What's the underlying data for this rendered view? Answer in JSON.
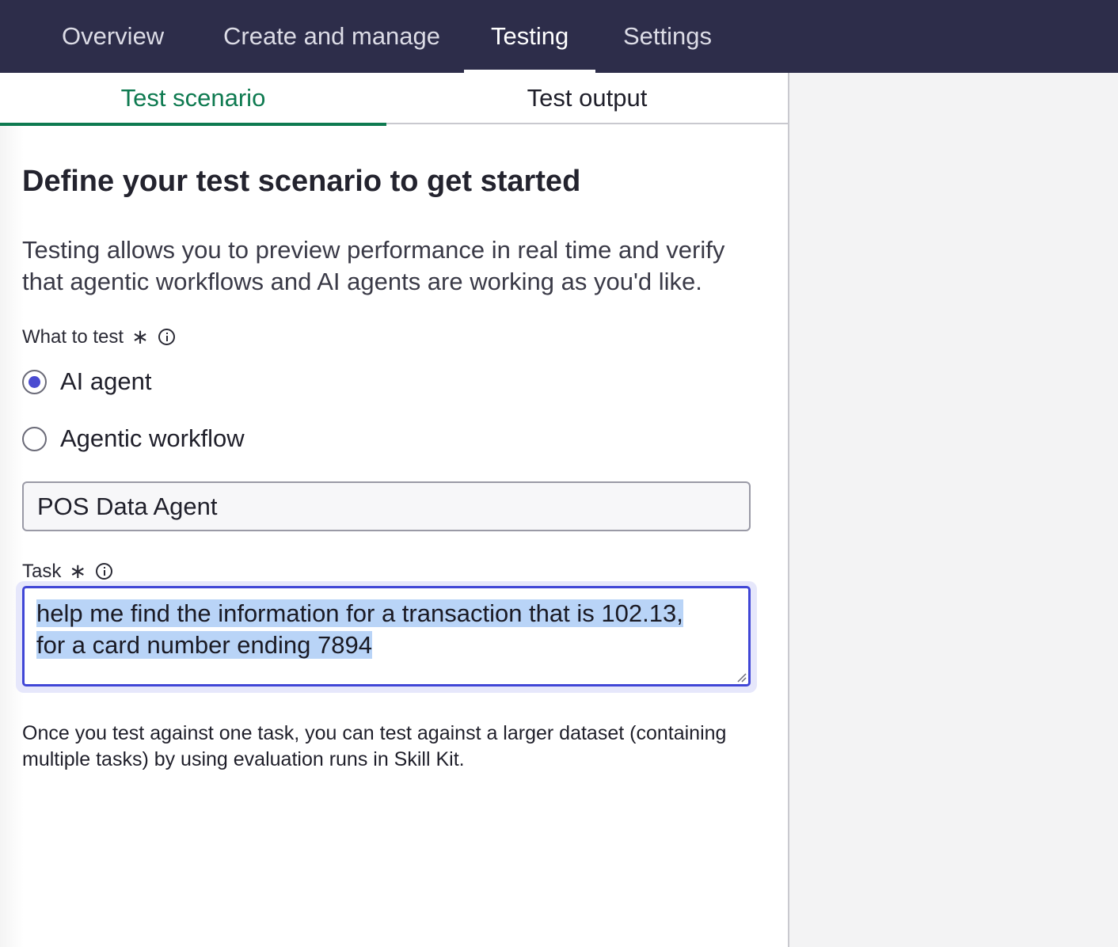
{
  "nav": {
    "tabs": [
      {
        "label": "Overview"
      },
      {
        "label": "Create and manage"
      },
      {
        "label": "Testing"
      },
      {
        "label": "Settings"
      }
    ],
    "active_tab": "Testing"
  },
  "subtabs": {
    "items": [
      {
        "label": "Test scenario"
      },
      {
        "label": "Test output"
      }
    ],
    "active": "Test scenario"
  },
  "main": {
    "heading": "Define your test scenario to get started",
    "intro": "Testing allows you to preview performance in real time and verify that agentic workflows and AI agents are working as you'd like.",
    "what_to_test": {
      "label": "What to test",
      "required_mark": "∗",
      "options": [
        {
          "label": "AI agent",
          "selected": true
        },
        {
          "label": "Agentic workflow",
          "selected": false
        }
      ]
    },
    "agent_select": {
      "value": "POS Data Agent"
    },
    "task": {
      "label": "Task",
      "required_mark": "∗",
      "value_line1": "help me find the information for a transaction that is 102.13,",
      "value_line2": "for a card number ending 7894"
    },
    "footnote": "Once you test against one task, you can test against a larger dataset (containing multiple tasks) by using evaluation runs in Skill Kit."
  },
  "colors": {
    "nav_bg": "#2d2d4a",
    "active_subtab": "#0e7a50",
    "radio_accent": "#4a4bd1",
    "focus_border": "#4046d6",
    "selection": "#b9d4f7"
  }
}
